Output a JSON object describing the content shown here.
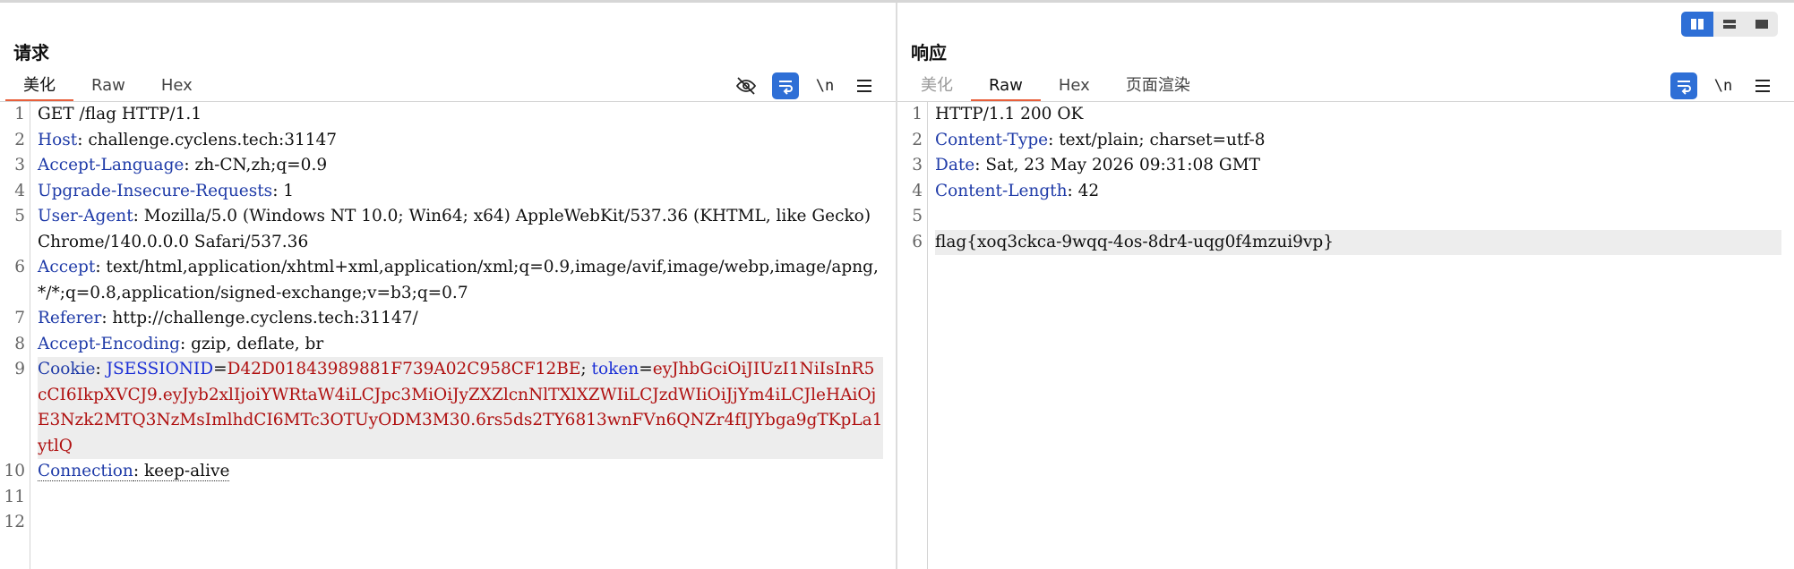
{
  "request": {
    "title": "请求",
    "tabs": [
      "美化",
      "Raw",
      "Hex"
    ],
    "toolbar": {
      "wrap_label": "\\n"
    },
    "lines": [
      {
        "n": "1",
        "parts": [
          [
            "v",
            "GET /flag HTTP/1.1"
          ]
        ]
      },
      {
        "n": "2",
        "parts": [
          [
            "k",
            "Host"
          ],
          [
            "v",
            ": challenge.cyclens.tech:31147"
          ]
        ]
      },
      {
        "n": "3",
        "parts": [
          [
            "k",
            "Accept-Language"
          ],
          [
            "v",
            ": zh-CN,zh;q=0.9"
          ]
        ]
      },
      {
        "n": "4",
        "parts": [
          [
            "k",
            "Upgrade-Insecure-Requests"
          ],
          [
            "v",
            ": 1"
          ]
        ]
      },
      {
        "n": "5",
        "parts": [
          [
            "k",
            "User-Agent"
          ],
          [
            "v",
            ": Mozilla/5.0 (Windows NT 10.0; Win64; x64) AppleWebKit/537.36 (KHTML, like Gecko) Chrome/140.0.0.0 Safari/537.36"
          ]
        ]
      },
      {
        "n": "6",
        "parts": [
          [
            "k",
            "Accept"
          ],
          [
            "v",
            ": text/html,application/xhtml+xml,application/xml;q=0.9,image/avif,image/webp,image/apng,*/*;q=0.8,application/signed-exchange;v=b3;q=0.7"
          ]
        ]
      },
      {
        "n": "7",
        "parts": [
          [
            "k",
            "Referer"
          ],
          [
            "v",
            ": http://challenge.cyclens.tech:31147/"
          ]
        ]
      },
      {
        "n": "8",
        "parts": [
          [
            "k",
            "Accept-Encoding"
          ],
          [
            "v",
            ": gzip, deflate, br"
          ]
        ]
      },
      {
        "n": "9",
        "hl": true,
        "parts": [
          [
            "k",
            "Cookie"
          ],
          [
            "v",
            ": "
          ],
          [
            "blu",
            "JSESSIONID"
          ],
          [
            "v",
            "="
          ],
          [
            "red",
            "D42D01843989881F739A02C958CF12BE"
          ],
          [
            "v",
            "; "
          ],
          [
            "blu",
            "token"
          ],
          [
            "v",
            "="
          ],
          [
            "red",
            "eyJhbGciOiJIUzI1NiIsInR5cCI6IkpXVCJ9.eyJyb2xlIjoiYWRtaW4iLCJpc3MiOiJyZXZlcnNlTXlXZWIiLCJzdWIiOiJjYm4iLCJleHAiOjE3Nzk2MTQ3NzMsImlhdCI6MTc3OTUyODM3M30.6rs5ds2TY6813wnFVn6QNZr4fIJYbga9gTKpLa1ytlQ"
          ]
        ]
      },
      {
        "n": "10",
        "parts": [
          [
            "kd",
            "Connection"
          ],
          [
            "vd",
            ": keep-alive"
          ]
        ]
      },
      {
        "n": "11",
        "parts": []
      },
      {
        "n": "12",
        "parts": []
      }
    ]
  },
  "response": {
    "title": "响应",
    "tabs": [
      "美化",
      "Raw",
      "Hex",
      "页面渲染"
    ],
    "toolbar": {
      "wrap_label": "\\n"
    },
    "lines": [
      {
        "n": "1",
        "parts": [
          [
            "v",
            "HTTP/1.1 200 OK"
          ]
        ]
      },
      {
        "n": "2",
        "parts": [
          [
            "k",
            "Content-Type"
          ],
          [
            "v",
            ": text/plain; charset=utf-8"
          ]
        ]
      },
      {
        "n": "3",
        "parts": [
          [
            "k",
            "Date"
          ],
          [
            "v",
            ": Sat, 23 May 2026 09:31:08 GMT"
          ]
        ]
      },
      {
        "n": "4",
        "parts": [
          [
            "k",
            "Content-Length"
          ],
          [
            "v",
            ": 42"
          ]
        ]
      },
      {
        "n": "5",
        "parts": []
      },
      {
        "n": "6",
        "hl": true,
        "parts": [
          [
            "v",
            "flag{xoq3ckca-9wqq-4os-8dr4-uqg0f4mzui9vp}"
          ]
        ]
      }
    ]
  },
  "colors": {
    "accent": "#2e6fd6",
    "tab_underline": "#e8603c",
    "header_key": "#1f3ba8",
    "cookie_value": "#b01111"
  }
}
